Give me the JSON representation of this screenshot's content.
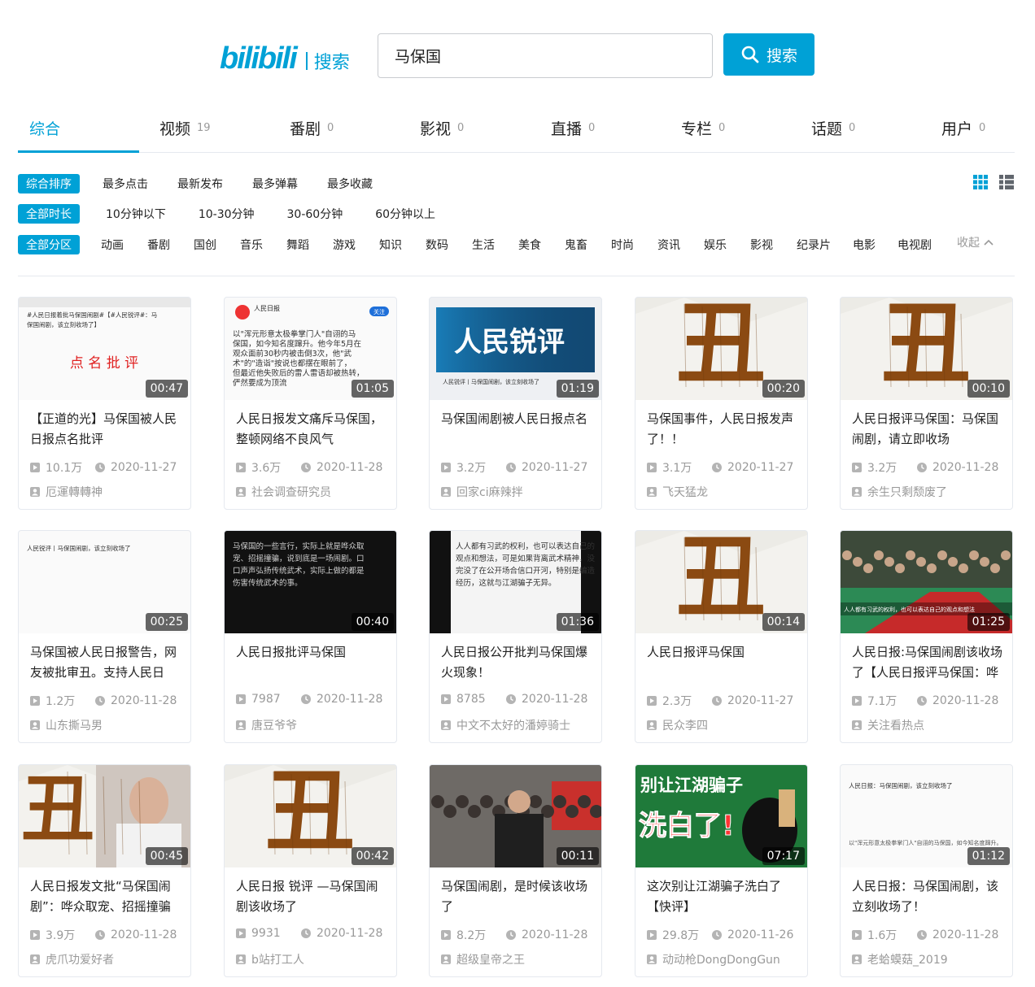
{
  "header": {
    "logo": "bilibili",
    "logo_subtitle": "搜索",
    "search_value": "马保国",
    "search_button": "搜索"
  },
  "tabs": [
    {
      "label": "综合",
      "count": ""
    },
    {
      "label": "视频",
      "count": "19"
    },
    {
      "label": "番剧",
      "count": "0"
    },
    {
      "label": "影视",
      "count": "0"
    },
    {
      "label": "直播",
      "count": "0"
    },
    {
      "label": "专栏",
      "count": "0"
    },
    {
      "label": "话题",
      "count": "0"
    },
    {
      "label": "用户",
      "count": "0"
    }
  ],
  "filters": {
    "sort": {
      "active": "综合排序",
      "options": [
        "最多点击",
        "最新发布",
        "最多弹幕",
        "最多收藏"
      ]
    },
    "duration": {
      "active": "全部时长",
      "options": [
        "10分钟以下",
        "10-30分钟",
        "30-60分钟",
        "60分钟以上"
      ]
    },
    "zone": {
      "active": "全部分区",
      "options": [
        "动画",
        "番剧",
        "国创",
        "音乐",
        "舞蹈",
        "游戏",
        "知识",
        "数码",
        "生活",
        "美食",
        "鬼畜",
        "时尚",
        "资讯",
        "娱乐",
        "影视",
        "纪录片",
        "电影",
        "电视剧"
      ],
      "collapse": "收起"
    }
  },
  "colors": {
    "accent": "#00a1d6",
    "thumb_brown": "#8b4a12"
  },
  "videos": [
    {
      "title": "【正道的光】马保国被人民日报点名批评",
      "duration": "00:47",
      "plays": "10.1万",
      "date": "2020-11-27",
      "uploader": "厄運轉轉神",
      "thumb": "doc",
      "thumb_text": "#人民日报着批马保国闹剧#【#人民锐评#：马保国闹剧，该立刻收场了】",
      "thumb_overlay": "点 名 批 评"
    },
    {
      "title": "人民日报发文痛斥马保国，整顿网络不良风气",
      "duration": "01:05",
      "plays": "3.6万",
      "date": "2020-11-28",
      "uploader": "社会调查研究员",
      "thumb": "doc2",
      "thumb_text": "以\"浑元形意太极拳掌门人\"自诩的马保国，如今知名度蹿升。他今年5月在观众面前30秒内被击倒3次，他\"武术\"的\"造诣\"按说也都摆在眼前了，但最近他失败后的雷人雷语却被热转，俨然要成为顶流",
      "thumb_header": "人民日报",
      "thumb_follow": "关注"
    },
    {
      "title": "马保国闹剧被人民日报点名",
      "duration": "01:19",
      "plays": "3.2万",
      "date": "2020-11-27",
      "uploader": "回家ci麻辣拌",
      "thumb": "banner",
      "thumb_text": "人民锐评",
      "thumb_caption": "人民锐评丨马保国闹剧，该立刻收场了"
    },
    {
      "title": "马保国事件，人民日报发声了！！",
      "duration": "00:20",
      "plays": "3.1万",
      "date": "2020-11-27",
      "uploader": "飞天猛龙",
      "thumb": "chou",
      "thumb_text": "丑"
    },
    {
      "title": "人民日报评马保国：马保国闹剧，请立即收场",
      "duration": "00:10",
      "plays": "3.2万",
      "date": "2020-11-28",
      "uploader": "余生只剩颓废了",
      "thumb": "chou",
      "thumb_text": "丑"
    },
    {
      "title": "马保国被人民日报警告，网友被批审丑。支持人民日",
      "duration": "00:25",
      "plays": "1.2万",
      "date": "2020-11-28",
      "uploader": "山东撕马男",
      "thumb": "doc3",
      "thumb_text": "人民锐评丨马保国闹剧，该立刻收场了"
    },
    {
      "title": "人民日报批评马保国",
      "duration": "00:40",
      "plays": "7987",
      "date": "2020-11-28",
      "uploader": "唐豆爷爷",
      "thumb": "dark",
      "thumb_text": "马保国的一些言行，实际上就是哗众取宠、招摇撞骗，说到底是一场闹剧。口口声声弘扬传统武术，实际上做的都是伤害传统武术的事。"
    },
    {
      "title": "人民日报公开批判马保国爆火现象！",
      "duration": "01:36",
      "plays": "8785",
      "date": "2020-11-28",
      "uploader": "中文不太好的潘婷骑士",
      "thumb": "dark-doc",
      "thumb_text": "人人都有习武的权利，也可以表达自己的观点和想法，可是如果背离武术精神，没完没了在公开场合信口开河，特别是编造经历，这就与江湖骗子无异。"
    },
    {
      "title": "人民日报评马保国",
      "duration": "00:14",
      "plays": "2.3万",
      "date": "2020-11-27",
      "uploader": "民众李四",
      "thumb": "chou",
      "thumb_text": "丑"
    },
    {
      "title": "人民日报:马保国闹剧该收场了【人民日报评马保国：哗",
      "duration": "01:25",
      "plays": "7.1万",
      "date": "2020-11-28",
      "uploader": "关注看热点",
      "thumb": "crowd",
      "thumb_text": "人人都有习武的权利，也可以表达自己的观点和想法"
    },
    {
      "title": "人民日报发文批“马保国闹剧”：哗众取宠、招摇撞骗",
      "duration": "00:45",
      "plays": "3.9万",
      "date": "2020-11-28",
      "uploader": "虎爪功爱好者",
      "thumb": "chou-man",
      "thumb_text": "丑"
    },
    {
      "title": "人民日报 锐评 —马保国闹剧该收场了",
      "duration": "00:42",
      "plays": "9931",
      "date": "2020-11-28",
      "uploader": "b站打工人",
      "thumb": "chou",
      "thumb_text": "丑"
    },
    {
      "title": "马保国闹剧，是时候该收场了",
      "duration": "00:11",
      "plays": "8.2万",
      "date": "2020-11-28",
      "uploader": "超级皇帝之王",
      "thumb": "crowd2",
      "thumb_text": ""
    },
    {
      "title": "这次别让江湖骗子洗白了【快评】",
      "duration": "07:17",
      "plays": "29.8万",
      "date": "2020-11-26",
      "uploader": "动动枪DongDongGun",
      "thumb": "green",
      "thumb_text": "别让江湖骗子",
      "thumb_text2": "洗白了!"
    },
    {
      "title": "人民日报：马保国闹剧，该立刻收场了！",
      "duration": "01:12",
      "plays": "1.6万",
      "date": "2020-11-28",
      "uploader": "老蛤蟆菇_2019",
      "thumb": "doc4",
      "thumb_text": "人民日报：马保国闹剧，该立刻收场了",
      "thumb_sub": "以\"浑元形意太极拳掌门人\"自诩的马保国，如今知名度蹿升。他今年5月在观众面前"
    }
  ]
}
